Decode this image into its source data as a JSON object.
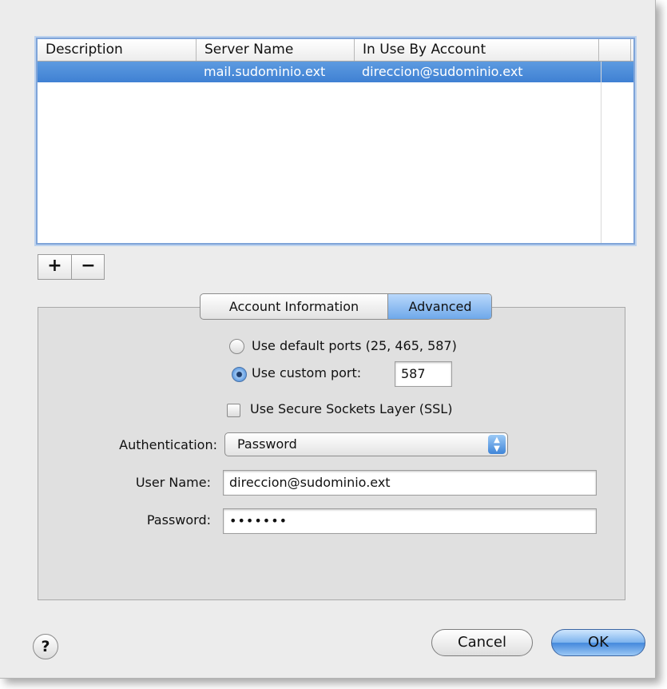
{
  "server_table": {
    "columns": [
      "Description",
      "Server Name",
      "In Use By Account"
    ],
    "rows": [
      {
        "description": "",
        "server_name": "mail.sudominio.ext",
        "account": "direccion@sudominio.ext"
      }
    ]
  },
  "list_buttons": {
    "add": "+",
    "remove": "−"
  },
  "tabs": {
    "account_info": "Account Information",
    "advanced": "Advanced",
    "selected": "Advanced"
  },
  "advanced": {
    "default_ports_label": "Use default ports (25, 465, 587)",
    "custom_port_label": "Use custom port:",
    "custom_port_value": "587",
    "ssl_label": "Use Secure Sockets Layer (SSL)",
    "authentication_label": "Authentication:",
    "authentication_value": "Password",
    "username_label": "User Name:",
    "username_value": "direccion@sudominio.ext",
    "password_label": "Password:",
    "password_value": "•••••••"
  },
  "footer": {
    "help": "?",
    "cancel": "Cancel",
    "ok": "OK"
  },
  "colors": {
    "selection": "#4f8ed9",
    "accent": "#6ea8ea"
  }
}
